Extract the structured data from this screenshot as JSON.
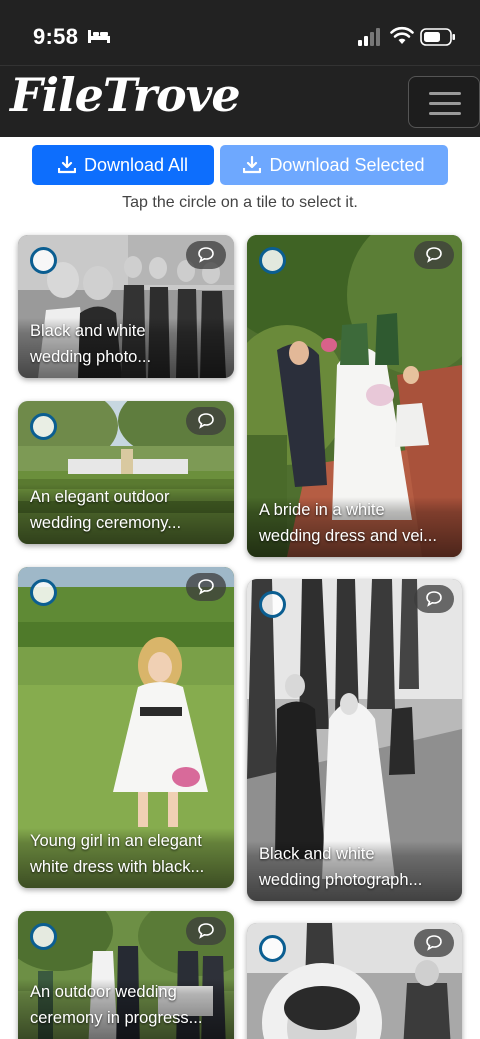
{
  "status_bar": {
    "time": "9:58"
  },
  "header": {
    "brand": "FileTrove"
  },
  "toolbar": {
    "download_all_label": "Download All",
    "download_selected_label": "Download Selected",
    "hint": "Tap the circle on a tile to select it."
  },
  "tiles": [
    {
      "caption_line1": "Black and white",
      "caption_line2": "wedding photo..."
    },
    {
      "caption_line1": "A bride in a white",
      "caption_line2": "wedding dress and vei..."
    },
    {
      "caption_line1": "An elegant outdoor",
      "caption_line2": "wedding ceremony..."
    },
    {
      "caption_line1": "Young girl in an elegant",
      "caption_line2": "white dress with black..."
    },
    {
      "caption_line1": "Black and white",
      "caption_line2": "wedding photograph..."
    },
    {
      "caption_line1": "An outdoor wedding",
      "caption_line2": "ceremony in progress..."
    },
    {
      "caption_line1": "",
      "caption_line2": ""
    }
  ],
  "colors": {
    "primary": "#0d6efd",
    "primary_disabled": "#6ea8fe",
    "header_bg": "#222222",
    "select_ring": "#0b5e91"
  },
  "icons": [
    "bed-icon",
    "signal-icon",
    "wifi-icon",
    "battery-icon",
    "menu-icon",
    "download-icon",
    "select-circle-icon",
    "comment-icon"
  ]
}
